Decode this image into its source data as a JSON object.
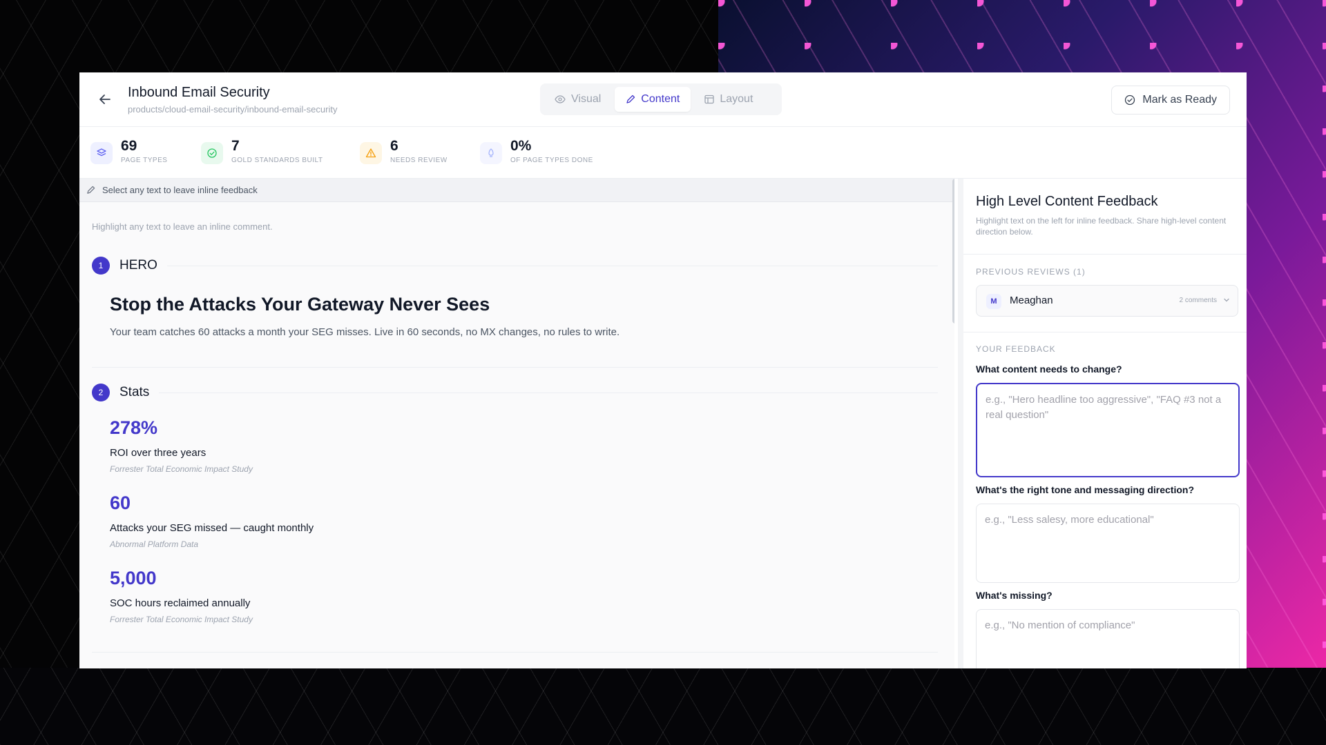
{
  "header": {
    "title": "Inbound Email Security",
    "path": "products/cloud-email-security/inbound-email-security",
    "tabs": [
      {
        "label": "Visual",
        "icon": "eye-icon"
      },
      {
        "label": "Content",
        "icon": "pencil-icon"
      },
      {
        "label": "Layout",
        "icon": "layout-icon"
      }
    ],
    "active_tab": "Content",
    "mark_ready_label": "Mark as Ready"
  },
  "stats": [
    {
      "value": "69",
      "label": "PAGE TYPES",
      "icon": "layers-icon",
      "color": "#6366f1"
    },
    {
      "value": "7",
      "label": "GOLD STANDARDS BUILT",
      "icon": "check-circle-icon",
      "color": "#22c55e"
    },
    {
      "value": "6",
      "label": "NEEDS REVIEW",
      "icon": "warning-icon",
      "color": "#f59e0b"
    },
    {
      "value": "0%",
      "label": "OF PAGE TYPES DONE",
      "icon": "rocket-icon",
      "color": "#a5b4fc"
    }
  ],
  "content": {
    "feedback_bar": "Select any text to leave inline feedback",
    "hint": "Highlight any text to leave an inline comment.",
    "sections": [
      {
        "number": "1",
        "title": "HERO"
      },
      {
        "number": "2",
        "title": "Stats"
      }
    ],
    "hero": {
      "headline": "Stop the Attacks Your Gateway Never Sees",
      "subhead": "Your team catches 60 attacks a month your SEG misses. Live in 60 seconds, no MX changes, no rules to write."
    },
    "stats_items": [
      {
        "value": "278%",
        "desc": "ROI over three years",
        "source": "Forrester Total Economic Impact Study"
      },
      {
        "value": "60",
        "desc": "Attacks your SEG missed — caught monthly",
        "source": "Abnormal Platform Data"
      },
      {
        "value": "5,000",
        "desc": "SOC hours reclaimed annually",
        "source": "Forrester Total Economic Impact Study"
      }
    ]
  },
  "panel": {
    "title": "High Level Content Feedback",
    "subtitle": "Highlight text on the left for inline feedback. Share high-level content direction below.",
    "previous_reviews_label": "PREVIOUS REVIEWS (1)",
    "review": {
      "initial": "M",
      "name": "Meaghan",
      "count": "2 comments"
    },
    "your_feedback_label": "YOUR FEEDBACK",
    "questions": [
      {
        "label": "What content needs to change?",
        "placeholder": "e.g., \"Hero headline too aggressive\", \"FAQ #3 not a real question\""
      },
      {
        "label": "What's the right tone and messaging direction?",
        "placeholder": "e.g., \"Less salesy, more educational\""
      },
      {
        "label": "What's missing?",
        "placeholder": "e.g., \"No mention of compliance\""
      }
    ]
  }
}
